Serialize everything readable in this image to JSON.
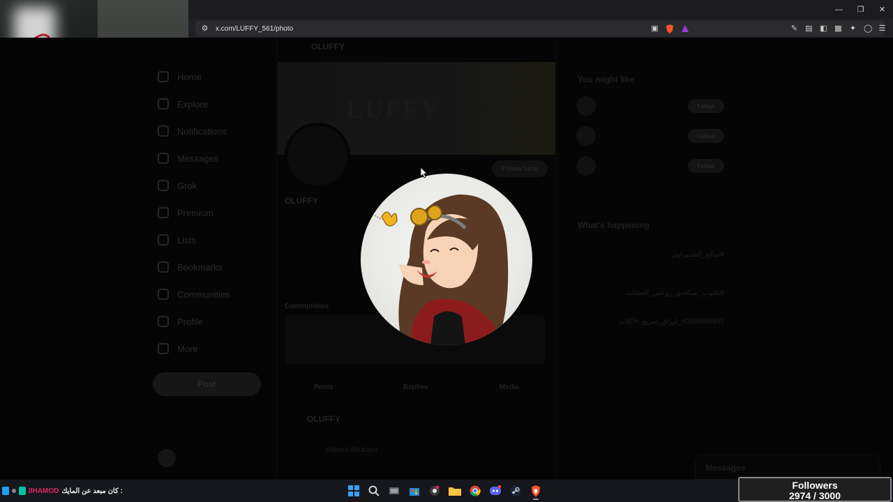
{
  "browser": {
    "url": "x.com/LUFFY_561/photo",
    "window_controls": [
      "minimize",
      "restore",
      "close"
    ]
  },
  "x_page": {
    "top_name": "OLUFFY",
    "banner_text": "LUFFY",
    "profile_name": "OLUFFY",
    "follow_back_label": "Follow back",
    "nav_items": [
      "Home",
      "Explore",
      "Notifications",
      "Messages",
      "Grok",
      "Premium",
      "Lists",
      "Bookmarks",
      "Communities",
      "Profile",
      "More"
    ],
    "post_label": "Post",
    "communities_label": "Communities",
    "tabs": [
      "Posts",
      "Replies",
      "Media"
    ],
    "post_author": "OLUFFY",
    "retweet_line": "Waleed Alrubaiei",
    "right": {
      "you_might_like": "You might like",
      "follow_label": "Follow",
      "whats_happening": "What's happening",
      "trends": [
        "#صالح_العصيراوي",
        "#تكتوب_تسافدي_زوجتي_العشاب",
        "#0598666997_اوراق_سريع_#اكلات"
      ],
      "messages_label": "Messages"
    }
  },
  "taskbar": {
    "chat_user": "IIHAMOD",
    "chat_message": "كان مبعد عن المايك :",
    "apps": [
      "start",
      "search",
      "task-view",
      "store",
      "chrome-like",
      "file-explorer",
      "chrome",
      "discord",
      "steam",
      "brave"
    ]
  },
  "followers_widget": {
    "label": "Followers",
    "count": "2974 / 3000",
    "current": 2974,
    "goal": 3000
  },
  "colors": {
    "chat_user": "#e0245e",
    "browser_chrome": "#1c1c1e",
    "taskbar": "#15171c"
  }
}
